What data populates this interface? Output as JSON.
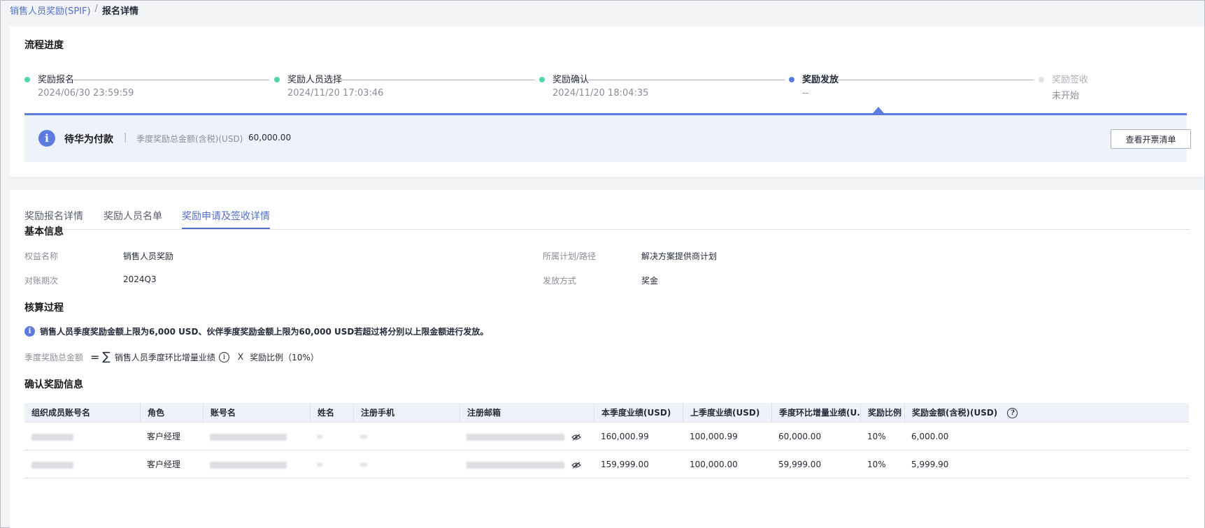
{
  "breadcrumb": {
    "parent": "销售人员奖励(SPIF)",
    "separator": "/",
    "current": "报名详情"
  },
  "progress": {
    "title": "流程进度",
    "steps": [
      {
        "label": "奖励报名",
        "time": "2024/06/30 23:59:59",
        "status": "done"
      },
      {
        "label": "奖励人员选择",
        "time": "2024/11/20 17:03:46",
        "status": "done"
      },
      {
        "label": "奖励确认",
        "time": "2024/11/20 18:04:35",
        "status": "done"
      },
      {
        "label": "奖励发放",
        "time": "--",
        "status": "active"
      },
      {
        "label": "奖励签收",
        "time": "未开始",
        "status": "todo"
      }
    ],
    "status": {
      "title": "待华为付款",
      "separator": "|",
      "amount_label": "季度奖励总金额(含税)(USD)",
      "amount_value": "60,000.00",
      "button": "查看开票清单"
    }
  },
  "tabs": [
    {
      "label": "奖励报名详情",
      "active": false
    },
    {
      "label": "奖励人员名单",
      "active": false
    },
    {
      "label": "奖励申请及签收详情",
      "active": true
    }
  ],
  "basic_info": {
    "title": "基本信息",
    "benefit_name_label": "权益名称",
    "benefit_name": "销售人员奖励",
    "plan_label": "所属计划/路径",
    "plan": "解决方案提供商计划",
    "period_label": "对账期次",
    "period": "2024Q3",
    "payout_label": "发放方式",
    "payout": "奖金"
  },
  "calc": {
    "title": "核算过程",
    "notice": "销售人员季度奖励金额上限为6,000 USD、伙伴季度奖励金额上限为60,000 USD若超过将分别以上限金额进行发放。",
    "formula_label": "季度奖励总金额",
    "formula_eq": "=",
    "formula_sum": "∑",
    "formula_term": "销售人员季度环比增量业绩",
    "formula_x": "X",
    "formula_ratio": "奖励比例（10%）"
  },
  "confirm": {
    "title": "确认奖励信息",
    "columns": [
      "组织成员账号名",
      "角色",
      "账号名",
      "姓名",
      "注册手机",
      "注册邮箱",
      "本季度业绩(USD)",
      "上季度业绩(USD)",
      "季度环比增量业绩(U...",
      "奖励比例",
      "奖励金额(含税)(USD)"
    ],
    "rows": [
      {
        "role": "客户经理",
        "current": "160,000.99",
        "previous": "100,000.99",
        "increment": "60,000.00",
        "ratio": "10%",
        "amount": "6,000.00"
      },
      {
        "role": "客户经理",
        "current": "159,999.00",
        "previous": "100,000.00",
        "increment": "59,999.00",
        "ratio": "10%",
        "amount": "5,999.90"
      }
    ]
  },
  "colors": {
    "accent": "#5e7ce0",
    "done": "#50d4ab",
    "todo": "#dfe1e6",
    "link": "#526ecc"
  }
}
